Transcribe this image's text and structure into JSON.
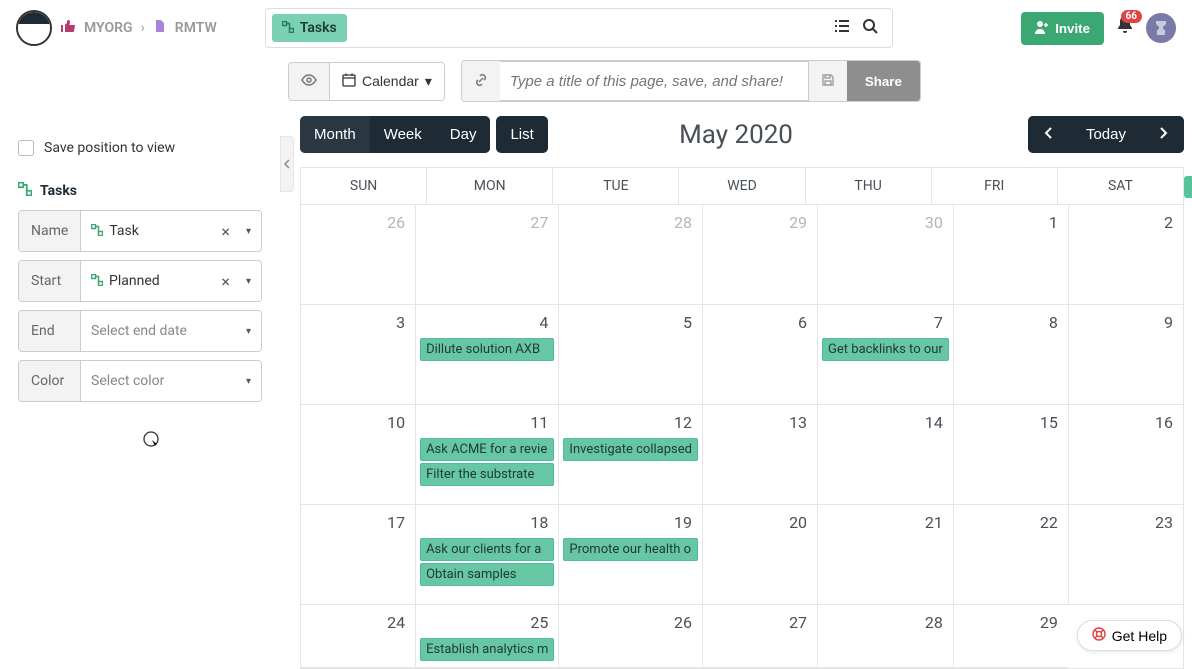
{
  "breadcrumb": {
    "org": "MYORG",
    "project": "RMTW"
  },
  "chip": {
    "label": "Tasks"
  },
  "invite": {
    "label": "Invite"
  },
  "notifications": {
    "count": "66"
  },
  "toolbar": {
    "calendar_label": "Calendar",
    "title_placeholder": "Type a title of this page, save, and share!",
    "share_label": "Share"
  },
  "sidebar": {
    "save_position": "Save position to view",
    "section": "Tasks",
    "fields": {
      "name": {
        "label": "Name",
        "value": "Task"
      },
      "start": {
        "label": "Start",
        "value": "Planned"
      },
      "end": {
        "label": "End",
        "placeholder": "Select end date"
      },
      "color": {
        "label": "Color",
        "placeholder": "Select color"
      }
    }
  },
  "calendar": {
    "views": {
      "month": "Month",
      "week": "Week",
      "day": "Day",
      "list": "List"
    },
    "title": "May 2020",
    "today": "Today",
    "day_headers": [
      "SUN",
      "MON",
      "TUE",
      "WED",
      "THU",
      "FRI",
      "SAT"
    ],
    "weeks": [
      [
        {
          "d": "26",
          "muted": true
        },
        {
          "d": "27",
          "muted": true
        },
        {
          "d": "28",
          "muted": true
        },
        {
          "d": "29",
          "muted": true
        },
        {
          "d": "30",
          "muted": true
        },
        {
          "d": "1"
        },
        {
          "d": "2"
        }
      ],
      [
        {
          "d": "3"
        },
        {
          "d": "4",
          "events": [
            "Dillute solution AXB"
          ]
        },
        {
          "d": "5"
        },
        {
          "d": "6"
        },
        {
          "d": "7",
          "events": [
            "Get backlinks to our"
          ]
        },
        {
          "d": "8"
        },
        {
          "d": "9"
        }
      ],
      [
        {
          "d": "10"
        },
        {
          "d": "11",
          "events": [
            "Ask ACME for a revie",
            "Filter the substrate"
          ]
        },
        {
          "d": "12",
          "events": [
            "Investigate collapsed"
          ]
        },
        {
          "d": "13"
        },
        {
          "d": "14"
        },
        {
          "d": "15"
        },
        {
          "d": "16"
        }
      ],
      [
        {
          "d": "17"
        },
        {
          "d": "18",
          "events": [
            "Ask our clients for a",
            "Obtain samples"
          ]
        },
        {
          "d": "19",
          "events": [
            "Promote our health o"
          ]
        },
        {
          "d": "20"
        },
        {
          "d": "21"
        },
        {
          "d": "22"
        },
        {
          "d": "23"
        }
      ],
      [
        {
          "d": "24"
        },
        {
          "d": "25",
          "events": [
            "Establish analytics m"
          ]
        },
        {
          "d": "26"
        },
        {
          "d": "27"
        },
        {
          "d": "28"
        },
        {
          "d": "29"
        }
      ]
    ]
  },
  "help": {
    "label": "Get Help"
  }
}
